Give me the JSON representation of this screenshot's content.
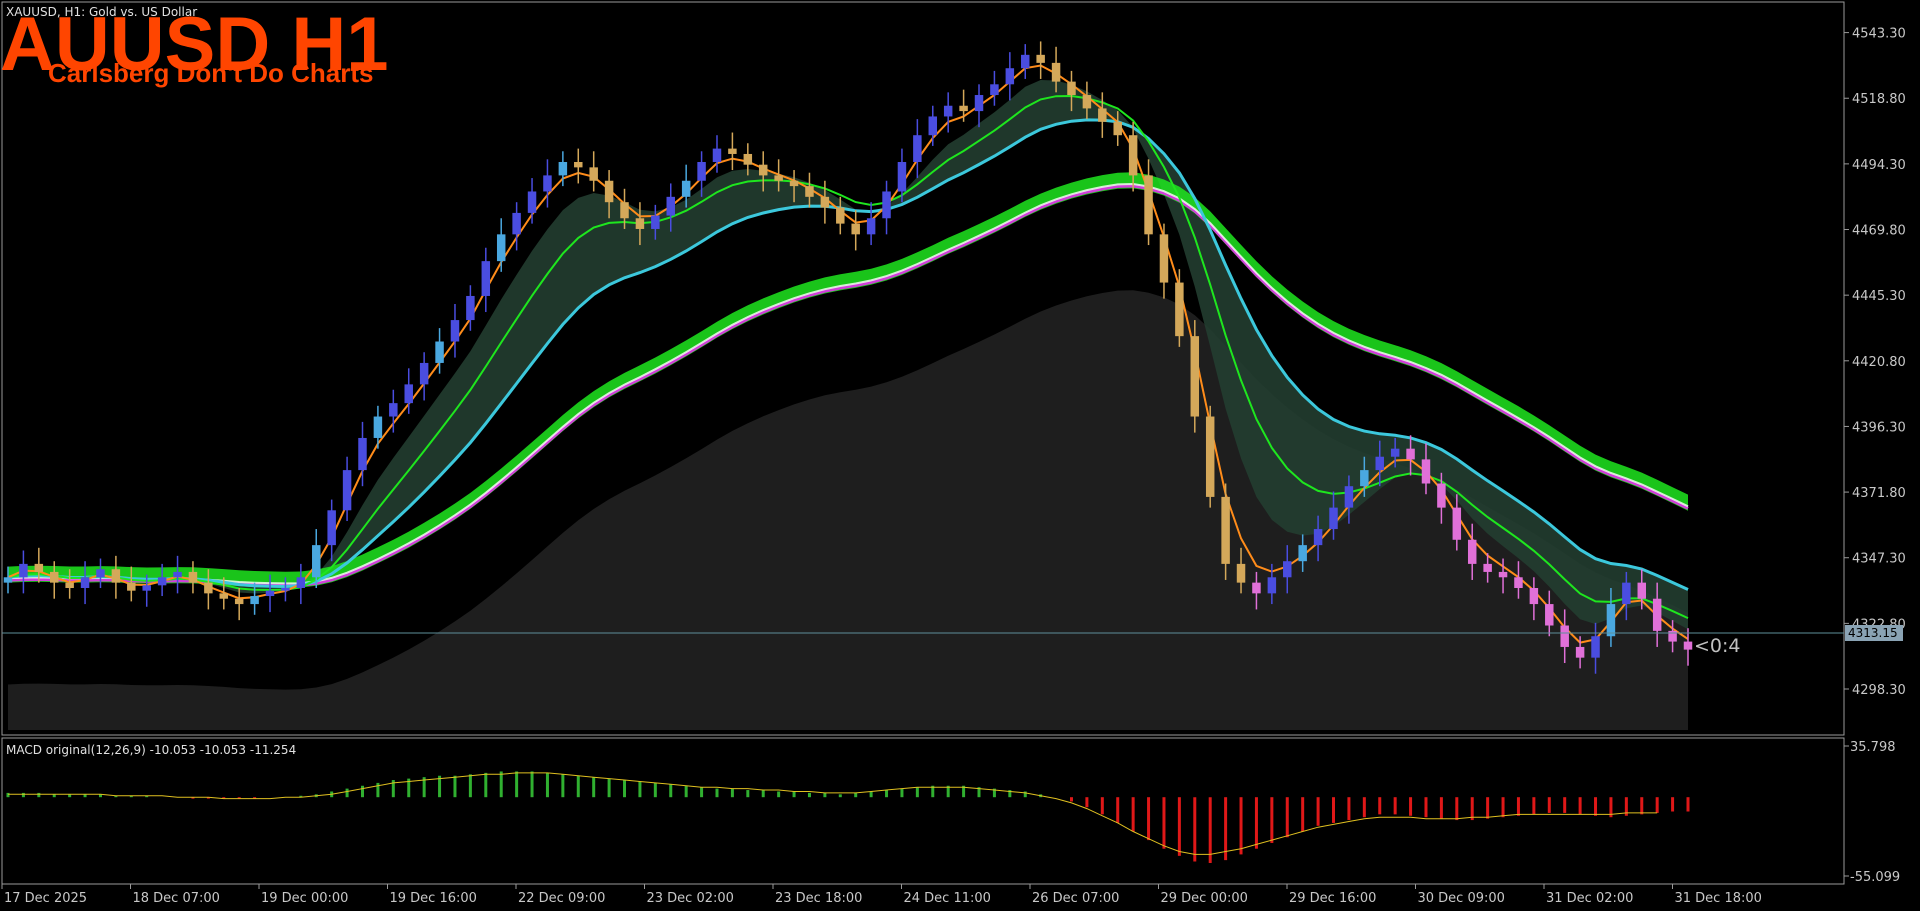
{
  "symbol_header": "XAUUSD, H1:  Gold vs. US Dollar",
  "big_title": "AUUSD H1",
  "subtitle": "Carlsberg Don't Do Charts",
  "timer_label": "<0:4",
  "colors": {
    "background": "#000000",
    "up_candle": "#4a4de0",
    "up_candle_light": "#4aa8e0",
    "down_candle_gold": "#d4a85a",
    "down_candle_pink": "#e070d8",
    "title": "#ff4500",
    "ema_fast": "#ff8c1a",
    "ema_green": "#1ee61e",
    "ema_cyan": "#3cc8dc",
    "ma_magenta": "#d040d8",
    "ma_white": "#ffffff",
    "band_green": "#1ee61e",
    "macd_up": "#30b030",
    "macd_down": "#e01818",
    "signal": "#e0c020"
  },
  "chart_data": [
    {
      "type": "line",
      "title": "XAUUSD, H1:  Gold vs. US Dollar",
      "xlabel": "",
      "ylabel": "",
      "x_ticks": [
        "17 Dec 2025",
        "18 Dec 07:00",
        "19 Dec 00:00",
        "19 Dec 16:00",
        "22 Dec 09:00",
        "23 Dec 02:00",
        "23 Dec 18:00",
        "24 Dec 11:00",
        "26 Dec 07:00",
        "29 Dec 00:00",
        "29 Dec 16:00",
        "30 Dec 09:00",
        "31 Dec 02:00",
        "31 Dec 18:00"
      ],
      "y_ticks": [
        "4543.30",
        "4518.80",
        "4494.30",
        "4469.80",
        "4445.30",
        "4420.80",
        "4396.30",
        "4371.80",
        "4347.30",
        "4322.80",
        "4298.30"
      ],
      "ylim": [
        4283,
        4548
      ],
      "current_price": "4313.15",
      "grid": false,
      "series": [
        {
          "name": "Price (H1 close, approx.)",
          "values": [
            4340,
            4345,
            4342,
            4338,
            4336,
            4340,
            4343,
            4338,
            4335,
            4337,
            4340,
            4342,
            4338,
            4334,
            4332,
            4330,
            4333,
            4335,
            4336,
            4340,
            4352,
            4365,
            4380,
            4392,
            4400,
            4405,
            4412,
            4420,
            4428,
            4436,
            4445,
            4458,
            4468,
            4476,
            4484,
            4490,
            4495,
            4493,
            4488,
            4480,
            4474,
            4470,
            4475,
            4482,
            4488,
            4495,
            4500,
            4498,
            4494,
            4490,
            4488,
            4486,
            4482,
            4478,
            4472,
            4468,
            4474,
            4484,
            4495,
            4505,
            4512,
            4516,
            4514,
            4520,
            4524,
            4530,
            4535,
            4532,
            4525,
            4520,
            4515,
            4510,
            4505,
            4490,
            4468,
            4450,
            4430,
            4400,
            4370,
            4345,
            4338,
            4334,
            4340,
            4346,
            4352,
            4358,
            4366,
            4374,
            4380,
            4385,
            4388,
            4384,
            4375,
            4366,
            4354,
            4345,
            4342,
            4340,
            4336,
            4330,
            4322,
            4314,
            4310,
            4318,
            4330,
            4338,
            4332,
            4320,
            4316,
            4313
          ]
        }
      ]
    },
    {
      "type": "bar",
      "title": "MACD original(12,26,9) -10.053 -10.053 -11.254",
      "y_ticks": [
        "35.798",
        "-55.099"
      ],
      "ylim": [
        -55.099,
        35.798
      ],
      "series": [
        {
          "name": "MACD original(12,26,9)",
          "values": [
            3,
            3,
            3,
            2,
            2,
            2,
            2,
            1,
            1,
            1,
            0,
            0,
            -1,
            -1,
            -1,
            -1,
            -1,
            0,
            0,
            1,
            2,
            4,
            6,
            8,
            10,
            12,
            13,
            14,
            15,
            15,
            16,
            17,
            18,
            18,
            18,
            17,
            16,
            15,
            14,
            13,
            12,
            11,
            10,
            9,
            8,
            7,
            6,
            6,
            5,
            5,
            4,
            4,
            3,
            3,
            2,
            3,
            4,
            5,
            6,
            7,
            8,
            8,
            8,
            7,
            6,
            5,
            4,
            2,
            0,
            -3,
            -7,
            -12,
            -18,
            -24,
            -30,
            -36,
            -41,
            -45,
            -46,
            -44,
            -40,
            -36,
            -32,
            -28,
            -24,
            -20,
            -18,
            -16,
            -14,
            -12,
            -12,
            -13,
            -14,
            -15,
            -16,
            -16,
            -15,
            -14,
            -13,
            -12,
            -11,
            -11,
            -12,
            -13,
            -14,
            -13,
            -12,
            -11,
            -10,
            -10
          ]
        },
        {
          "name": "Signal",
          "values": [
            2,
            2,
            2,
            2,
            2,
            2,
            2,
            1,
            1,
            1,
            1,
            0,
            0,
            0,
            -1,
            -1,
            -1,
            -1,
            0,
            0,
            1,
            2,
            4,
            6,
            8,
            10,
            11,
            12,
            13,
            14,
            15,
            16,
            16,
            17,
            17,
            17,
            16,
            15,
            14,
            13,
            12,
            11,
            10,
            9,
            8,
            7,
            7,
            6,
            6,
            5,
            5,
            4,
            4,
            3,
            3,
            3,
            4,
            5,
            6,
            7,
            7,
            7,
            7,
            6,
            5,
            4,
            3,
            1,
            -1,
            -4,
            -8,
            -13,
            -18,
            -24,
            -29,
            -34,
            -38,
            -40,
            -40,
            -38,
            -36,
            -33,
            -30,
            -27,
            -24,
            -21,
            -19,
            -17,
            -15,
            -14,
            -14,
            -14,
            -15,
            -15,
            -15,
            -14,
            -14,
            -13,
            -12,
            -12,
            -12,
            -12,
            -12,
            -12,
            -12,
            -11,
            -11,
            -11
          ]
        }
      ]
    }
  ]
}
